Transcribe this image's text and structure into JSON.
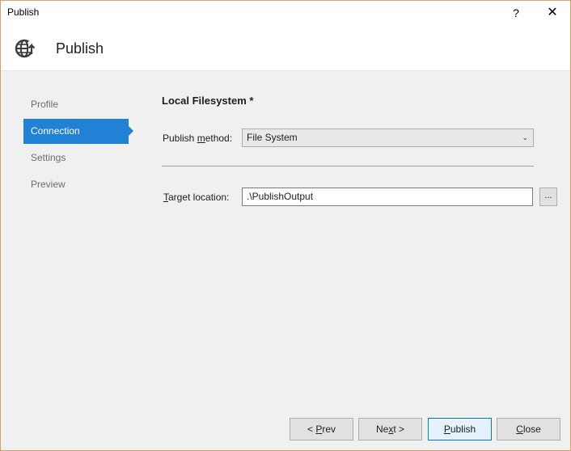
{
  "window": {
    "title": "Publish",
    "help_label": "?",
    "close_label": "✕"
  },
  "header": {
    "heading": "Publish",
    "icon": "globe-publish-icon"
  },
  "nav": {
    "items": [
      {
        "label": "Profile",
        "active": false
      },
      {
        "label": "Connection",
        "active": true
      },
      {
        "label": "Settings",
        "active": false
      },
      {
        "label": "Preview",
        "active": false
      }
    ]
  },
  "main": {
    "section_title": "Local Filesystem *",
    "publish_method": {
      "label_pre": "Publish ",
      "label_accel": "m",
      "label_post": "ethod:",
      "value": "File System"
    },
    "target_location": {
      "label_accel": "T",
      "label_post": "arget location:",
      "value": ".\\PublishOutput",
      "browse_label": "..."
    }
  },
  "buttons": {
    "prev": {
      "pre": "< ",
      "accel": "P",
      "post": "rev"
    },
    "next": {
      "pre": "Ne",
      "accel": "x",
      "post": "t >"
    },
    "publish": {
      "pre": "",
      "accel": "P",
      "post": "ublish"
    },
    "close": {
      "pre": "",
      "accel": "C",
      "post": "lose"
    }
  },
  "colors": {
    "accent": "#2181d4",
    "window_border": "#d9a066",
    "primary_button_border": "#0078d7"
  }
}
